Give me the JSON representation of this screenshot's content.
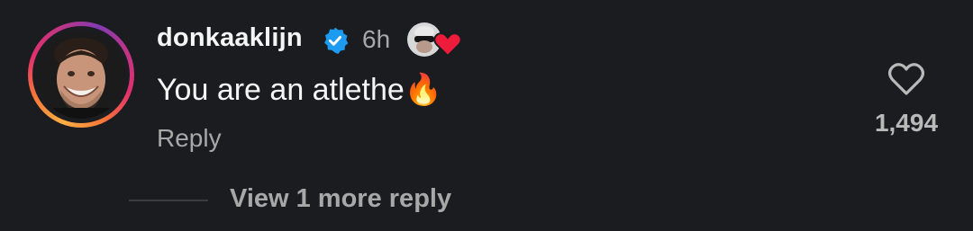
{
  "comment": {
    "username": "donkaaklijn",
    "verified": true,
    "time": "6h",
    "text": "You are an atlethe",
    "emoji": "🔥",
    "reply_label": "Reply",
    "like_count": "1,494",
    "view_replies_label": "View 1 more reply"
  },
  "colors": {
    "background": "#1a1c20",
    "verified_badge": "#1d9bf0",
    "liked_heart": "#ed1c3a",
    "secondary_text": "#a8a8a8"
  },
  "icons": {
    "verified": "verified-badge-icon",
    "like": "heart-outline-icon",
    "liked_by_author": "creator-liked-heart-icon"
  }
}
